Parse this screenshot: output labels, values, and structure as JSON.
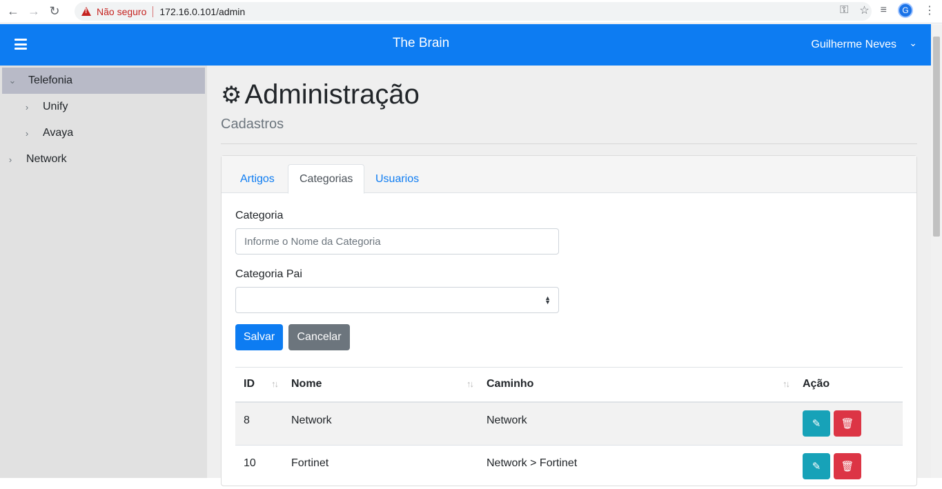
{
  "browser": {
    "security_label": "Não seguro",
    "url": "172.16.0.101/admin",
    "profile_initial": "G"
  },
  "header": {
    "brand": "The Brain",
    "user": "Guilherme Neves"
  },
  "sidebar": {
    "items": [
      {
        "label": "Telefonia",
        "expanded": true,
        "selected": true
      },
      {
        "label": "Unify",
        "expanded": false
      },
      {
        "label": "Avaya",
        "expanded": false
      },
      {
        "label": "Network",
        "expanded": false
      }
    ]
  },
  "page": {
    "title": "Administração",
    "subtitle": "Cadastros"
  },
  "tabs": [
    {
      "label": "Artigos",
      "active": false
    },
    {
      "label": "Categorias",
      "active": true
    },
    {
      "label": "Usuarios",
      "active": false
    }
  ],
  "form": {
    "category_label": "Categoria",
    "category_placeholder": "Informe o Nome da Categoria",
    "parent_label": "Categoria Pai",
    "parent_value": "",
    "save_label": "Salvar",
    "cancel_label": "Cancelar"
  },
  "table": {
    "headers": [
      "ID",
      "Nome",
      "Caminho",
      "Ação"
    ],
    "rows": [
      {
        "id": "8",
        "nome": "Network",
        "caminho": "Network"
      },
      {
        "id": "10",
        "nome": "Fortinet",
        "caminho": "Network > Fortinet"
      }
    ]
  },
  "colors": {
    "primary": "#0d7cf2",
    "edit": "#17a2b8",
    "delete": "#dc3545"
  }
}
